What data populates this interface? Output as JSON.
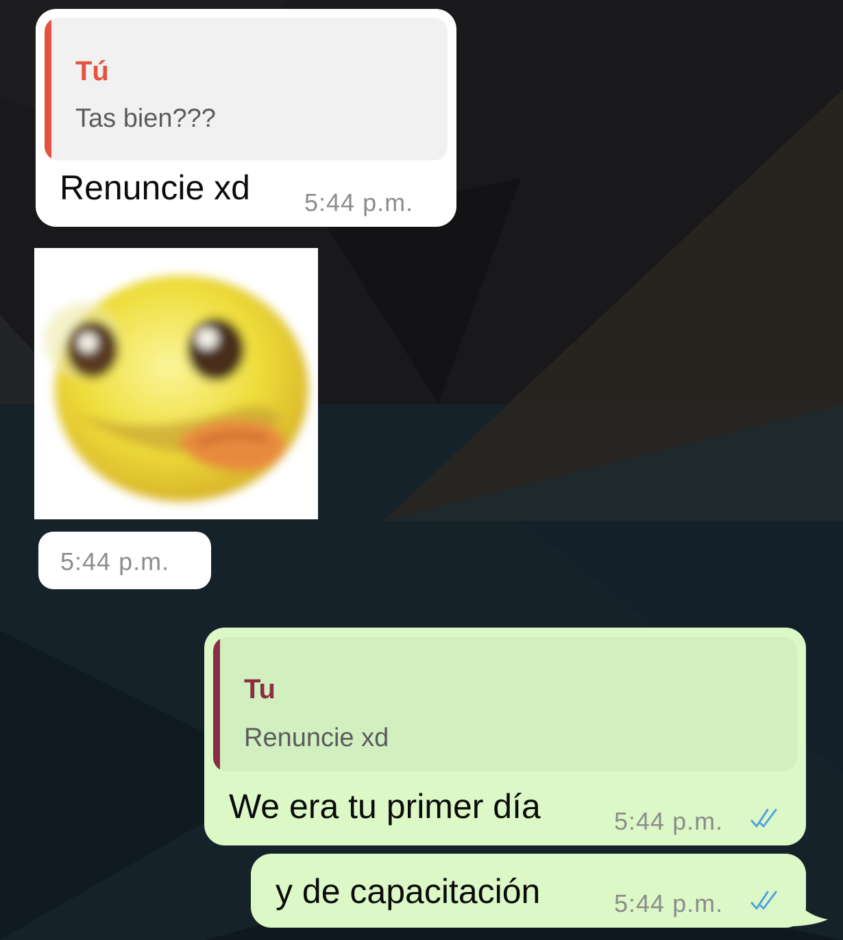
{
  "messages": [
    {
      "direction": "incoming",
      "quote": {
        "author": "Tú",
        "text": "Tas bien???"
      },
      "text": "Renuncie xd",
      "time": "5:44 p.m."
    },
    {
      "direction": "incoming",
      "type": "sticker",
      "sticker_icon": "drooling-face-sticker",
      "time": "5:44 p.m."
    },
    {
      "direction": "outgoing",
      "quote": {
        "author": "Tu",
        "text": "Renuncie xd"
      },
      "text": "We era tu primer día",
      "time": "5:44 p.m.",
      "status_icon": "double-check-read-icon"
    },
    {
      "direction": "outgoing",
      "text": "y de capacitación",
      "time": "5:44 p.m.",
      "status_icon": "double-check-read-icon"
    }
  ],
  "colors": {
    "quote_author_incoming": "#e5533e",
    "quote_author_outgoing": "#8a2d45",
    "incoming_bubble": "#ffffff",
    "outgoing_bubble": "#dcf8c6",
    "read_ticks": "#4fa3e0"
  }
}
